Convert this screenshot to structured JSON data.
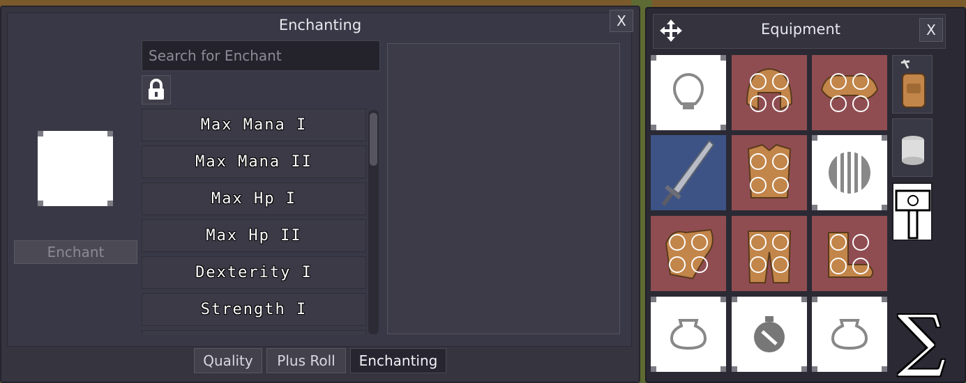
{
  "enchanting": {
    "title": "Enchanting",
    "close_label": "X",
    "search_placeholder": "Search for Enchant",
    "enchant_button": "Enchant",
    "enchant_list": [
      {
        "label": "Max Mana I"
      },
      {
        "label": "Max Mana II"
      },
      {
        "label": "Max Hp I"
      },
      {
        "label": "Max Hp II"
      },
      {
        "label": "Dexterity I"
      },
      {
        "label": "Strength I"
      }
    ],
    "tabs": [
      {
        "label": "Quality",
        "active": false
      },
      {
        "label": "Plus Roll",
        "active": false
      },
      {
        "label": "Enchanting",
        "active": true
      }
    ]
  },
  "equipment": {
    "title": "Equipment",
    "close_label": "X",
    "slots": [
      {
        "item": "empty-head-slot",
        "color": "#ffffff"
      },
      {
        "item": "leather-helmet",
        "color": "#8f4d52"
      },
      {
        "item": "leather-shoulders",
        "color": "#8f4d52"
      },
      {
        "item": "steel-sword",
        "color": "#3d5386"
      },
      {
        "item": "leather-chestpiece",
        "color": "#8f4d52"
      },
      {
        "item": "empty-shield-slot",
        "color": "#ffffff"
      },
      {
        "item": "leather-gloves",
        "color": "#8f4d52"
      },
      {
        "item": "leather-pants",
        "color": "#8f4d52"
      },
      {
        "item": "leather-boots",
        "color": "#8f4d52"
      },
      {
        "item": "empty-ring-slot",
        "color": "#ffffff"
      },
      {
        "item": "empty-amulet-slot",
        "color": "#ffffff"
      },
      {
        "item": "empty-ring-slot",
        "color": "#ffffff"
      }
    ],
    "side_tabs": [
      "backpack-icon",
      "stone-tower-icon",
      "hammer-icon"
    ],
    "stats_glyph": "∑"
  }
}
